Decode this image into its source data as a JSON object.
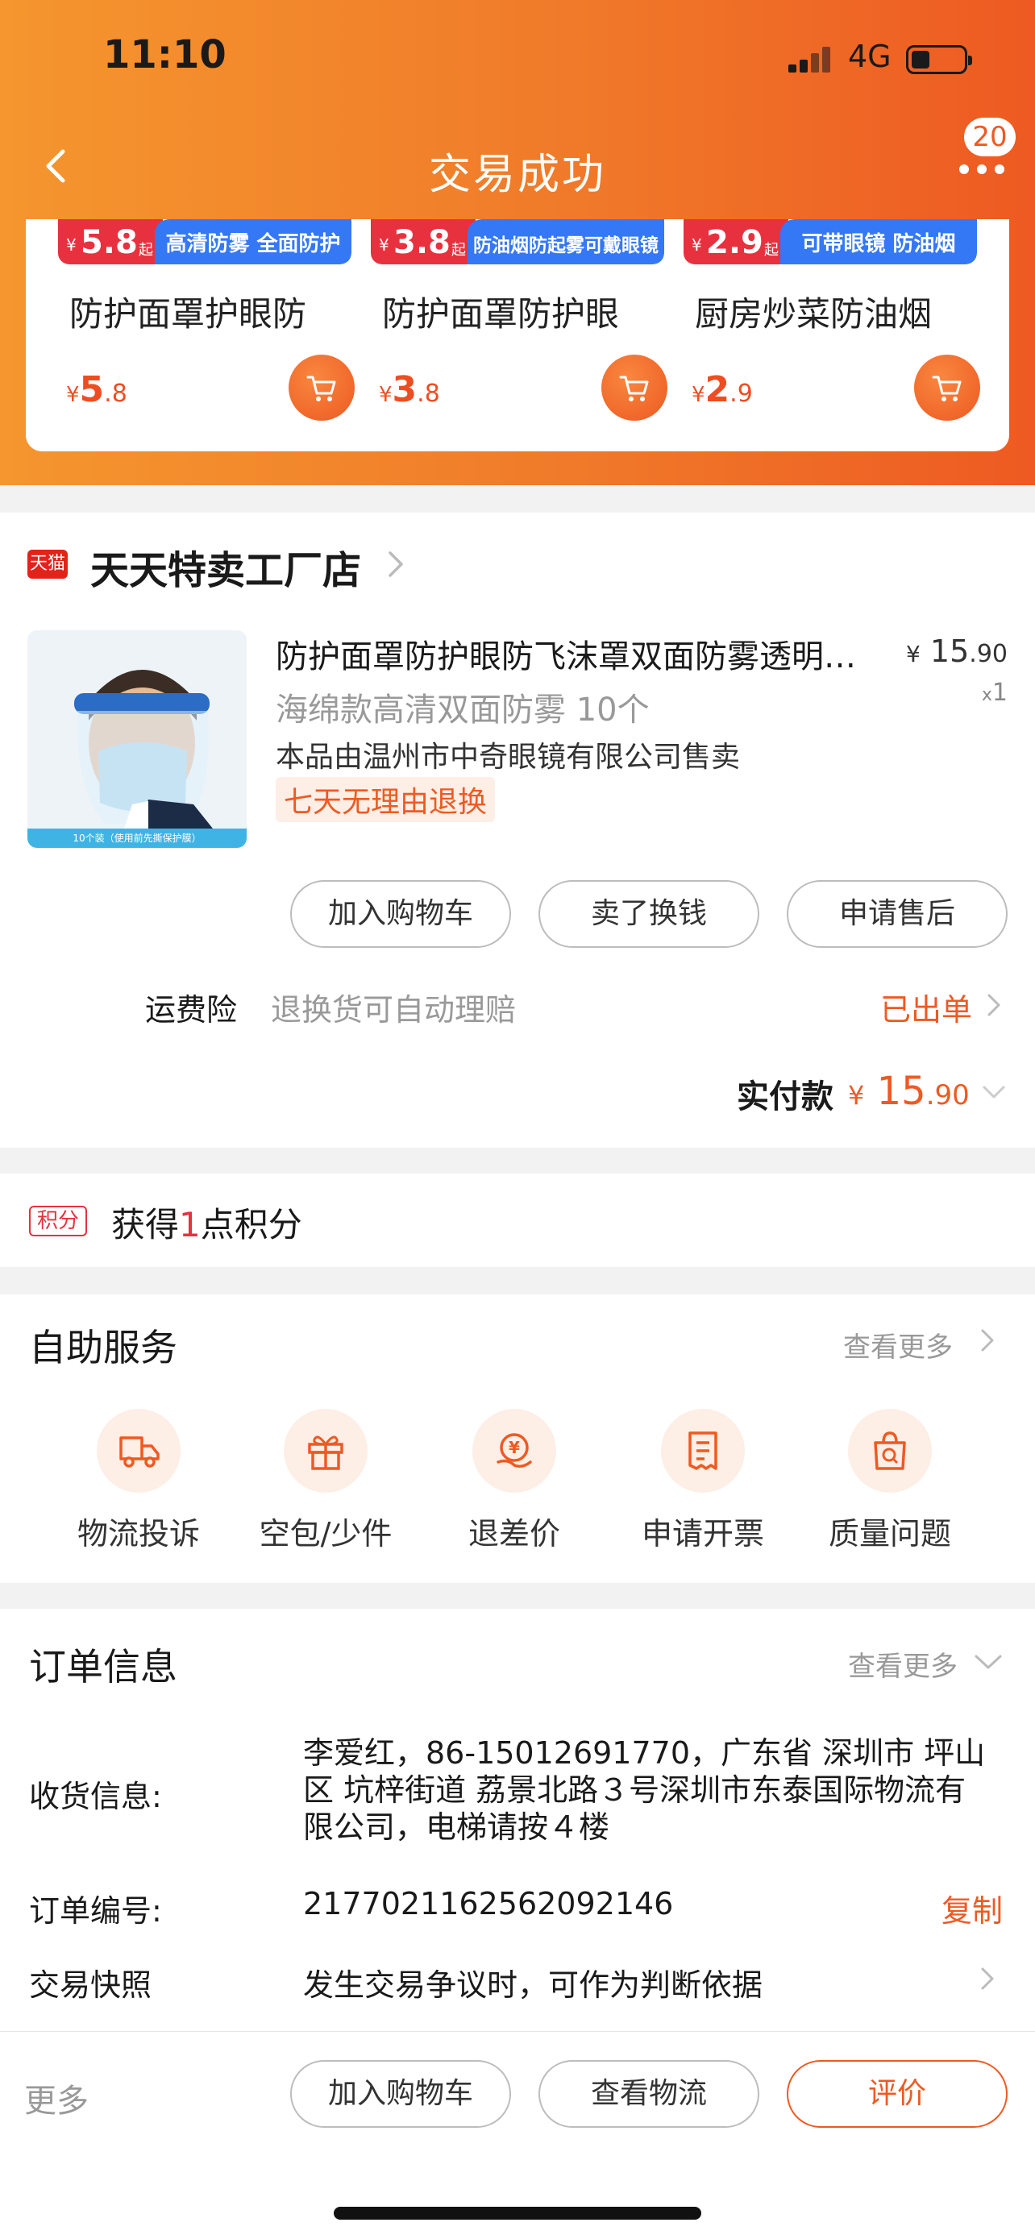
{
  "status_bar": {
    "time": "11:10",
    "network": "4G"
  },
  "nav": {
    "title": "交易成功",
    "badge_count": "20"
  },
  "recommendations": [
    {
      "banner_price": "5.8",
      "banner_qi": "起",
      "banner_tag": "高清防雾 全面防护",
      "name": "防护面罩护眼防",
      "price_yen": "¥",
      "price_int": "5",
      "price_dec": ".8"
    },
    {
      "banner_price": "3.8",
      "banner_qi": "起",
      "banner_tag": "防油烟防起雾可戴眼镜",
      "name": "防护面罩防护眼",
      "price_yen": "¥",
      "price_int": "3",
      "price_dec": ".8"
    },
    {
      "banner_price": "2.9",
      "banner_qi": "起",
      "banner_tag": "可带眼镜 防油烟",
      "name": "厨房炒菜防油烟",
      "price_yen": "¥",
      "price_int": "2",
      "price_dec": ".9"
    }
  ],
  "store": {
    "platform_badge": "天猫",
    "name": "天天特卖工厂店"
  },
  "product": {
    "title": "防护面罩防护眼防飞沫罩双面防雾透明面屏",
    "image_strip": "10个装（使用前先撕保护膜）",
    "price_yen": "¥",
    "price_int": "15",
    "price_dec": ".90",
    "qty_x": "x",
    "qty": "1",
    "sku": "海绵款高清双面防雾 10个",
    "seller": "本品由温州市中奇眼镜有限公司售卖",
    "return_policy": "七天无理由退换"
  },
  "product_actions": [
    "加入购物车",
    "卖了换钱",
    "申请售后"
  ],
  "insurance": {
    "label": "运费险",
    "desc": "退换货可自动理赔",
    "status": "已出单"
  },
  "payment": {
    "label": "实付款",
    "yen": "¥",
    "int": "15",
    "dec": ".90"
  },
  "points": {
    "tag": "积分",
    "prefix": "获得",
    "count": "1",
    "suffix": "点积分"
  },
  "self_service": {
    "title": "自助服务",
    "more": "查看更多",
    "items": [
      {
        "label": "物流投诉",
        "icon": "truck-icon"
      },
      {
        "label": "空包/少件",
        "icon": "gift-icon"
      },
      {
        "label": "退差价",
        "icon": "refund-icon"
      },
      {
        "label": "申请开票",
        "icon": "receipt-icon"
      },
      {
        "label": "质量问题",
        "icon": "quality-bag-icon"
      }
    ]
  },
  "order_info": {
    "title": "订单信息",
    "more": "查看更多",
    "address_label": "收货信息:",
    "address_lines": [
      "李爱红，86-15012691770，广东省 深圳市 坪山",
      "区 坑梓街道 荔景北路３号深圳市东泰国际物流有",
      "限公司，电梯请按４楼"
    ],
    "order_no_label": "订单编号:",
    "order_no": "2177021162562092146",
    "copy": "复制",
    "snapshot_label": "交易快照",
    "snapshot_desc": "发生交易争议时，可作为判断依据"
  },
  "bottom_bar": {
    "more": "更多",
    "buttons": [
      "加入购物车",
      "查看物流",
      "评价"
    ]
  },
  "colors": {
    "accent": "#ee5a22",
    "hero_start": "#f5962e",
    "hero_end": "#ee5a22",
    "red": "#e8313f",
    "blue": "#3478f6"
  }
}
